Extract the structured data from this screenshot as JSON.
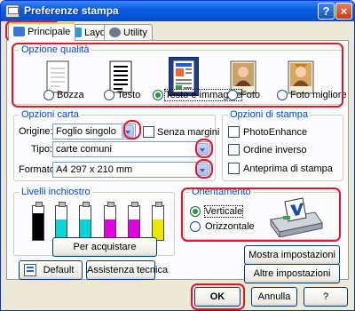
{
  "window": {
    "title": "Preferenze stampa",
    "help_label": "?",
    "close_label": "×"
  },
  "tabs": [
    {
      "label": "Principale",
      "accent": "#3a78d8"
    },
    {
      "label": "Layout",
      "accent": "#2f9ad0"
    },
    {
      "label": "Utility",
      "accent": "#6b7a8c"
    }
  ],
  "quality": {
    "label": "Opzione qualità",
    "options": [
      {
        "label": "Bozza",
        "icon": "draft-document-icon"
      },
      {
        "label": "Testo",
        "icon": "text-document-icon"
      },
      {
        "label": "Testo e immagine",
        "icon": "text-image-document-icon",
        "selected": true
      },
      {
        "label": "Foto",
        "icon": "photo-icon"
      },
      {
        "label": "Foto migliore",
        "icon": "best-photo-icon"
      }
    ]
  },
  "paper": {
    "label": "Opzioni carta",
    "source_label": "Origine:",
    "source_value": "Foglio singolo",
    "borderless_label": "Senza margini",
    "type_label": "Tipo:",
    "type_value": "carte comuni",
    "size_label": "Formato:",
    "size_value": "A4 297 x 210 mm"
  },
  "print_options": {
    "label": "Opzioni di stampa",
    "items": [
      "PhotoEnhance",
      "Ordine inverso",
      "Anteprima di stampa"
    ]
  },
  "ink": {
    "label": "Livelli inchiostro",
    "cartridges": [
      {
        "color": "#000000",
        "level": 0.78
      },
      {
        "color": "#00d8d8",
        "level": 0.6
      },
      {
        "color": "#00d8d8",
        "level": 0.6
      },
      {
        "color": "#e000e0",
        "level": 0.6
      },
      {
        "color": "#e000e0",
        "level": 0.6
      },
      {
        "color": "#e8e800",
        "level": 0.6
      }
    ],
    "buy_label": "Per acquistare"
  },
  "orientation": {
    "label": "Orientamento",
    "options": [
      {
        "label": "Verticale",
        "selected": true
      },
      {
        "label": "Orizzontale",
        "selected": false
      }
    ]
  },
  "buttons": {
    "default_label": "Default",
    "support_label": "Assistenza tecnica",
    "show_settings_label": "Mostra impostazioni",
    "other_settings_label": "Altre impostazioni",
    "ok_label": "OK",
    "cancel_label": "Annulla",
    "help_label": "?"
  },
  "colors": {
    "highlight": "#e8132a",
    "group_label": "#0046d5"
  }
}
